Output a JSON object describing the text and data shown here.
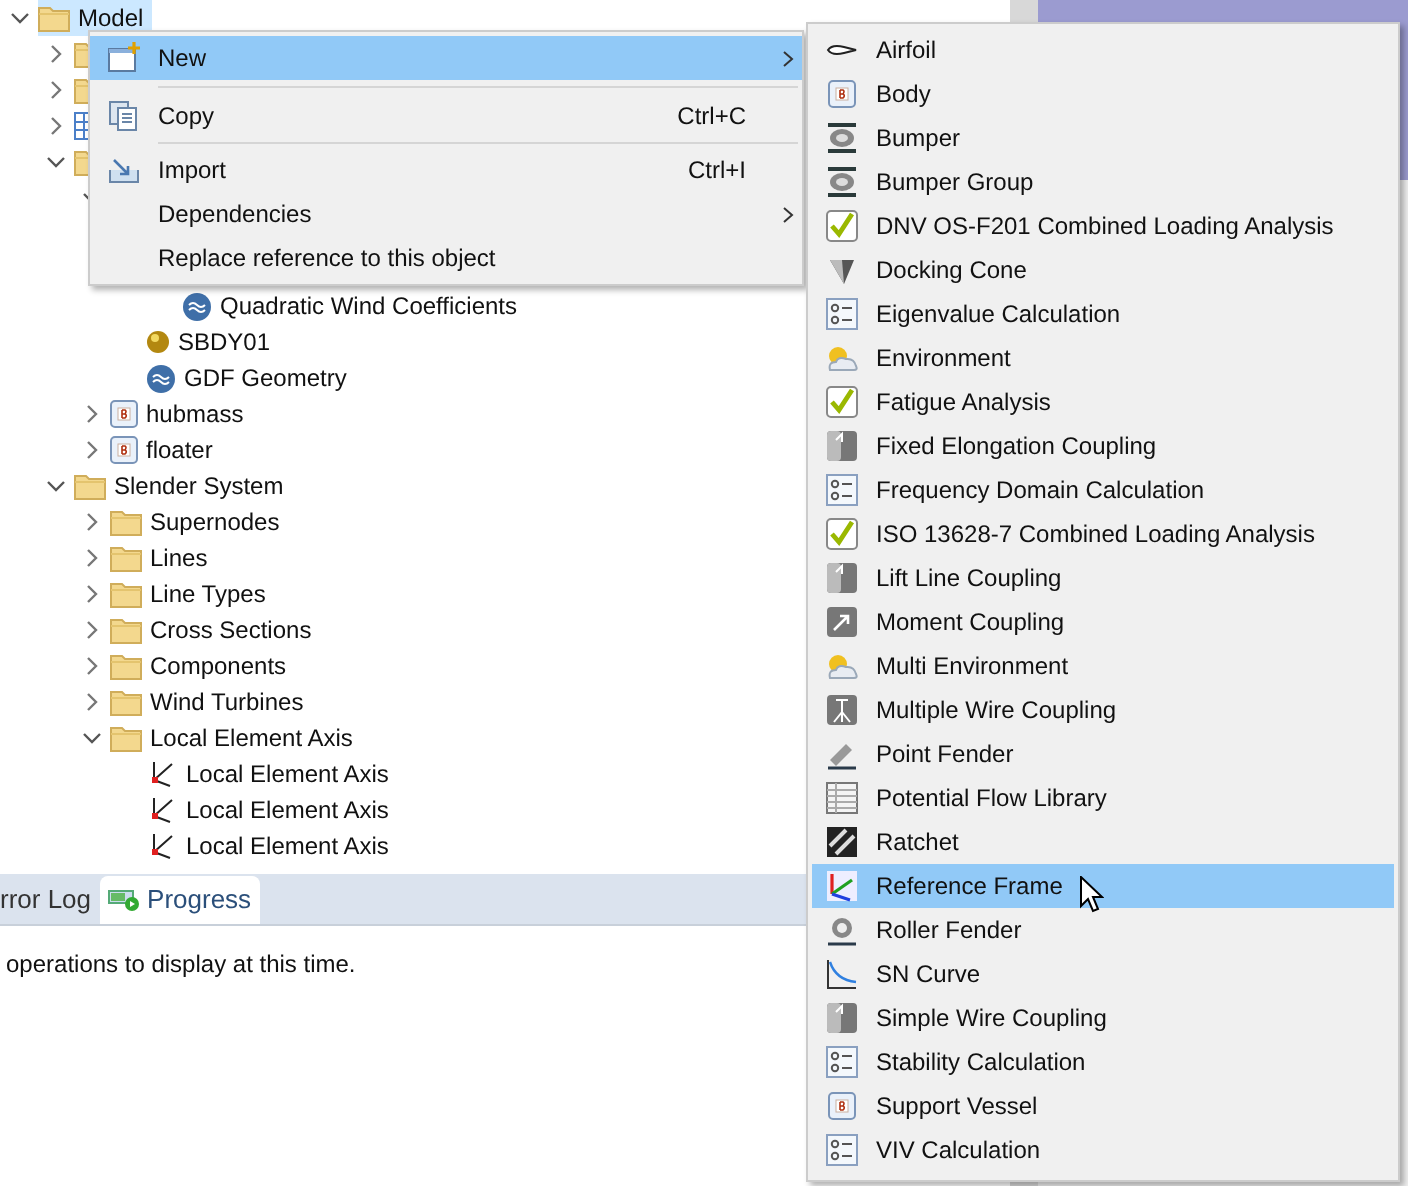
{
  "tree": [
    {
      "label": "Model",
      "kind": "folder",
      "expanded": true,
      "selected": true,
      "children": [
        {
          "kind": "folder",
          "expanded": false
        },
        {
          "kind": "folder",
          "expanded": false
        },
        {
          "kind": "grid",
          "expanded": false
        },
        {
          "kind": "folder",
          "expanded": true,
          "children": [
            {
              "kind": "hidden",
              "expanded": true,
              "children": [
                {
                  "kind": "hidden",
                  "children": [
                    {
                      "kind": "hidden"
                    },
                    {
                      "label": "Quadratic Wind Coefficients",
                      "kind": "wave"
                    }
                  ]
                },
                {
                  "label": "SBDY01",
                  "kind": "ball"
                },
                {
                  "label": "GDF Geometry",
                  "kind": "wave"
                }
              ]
            },
            {
              "label": "hubmass",
              "kind": "body",
              "expanded": false
            },
            {
              "label": "floater",
              "kind": "body",
              "expanded": false
            }
          ]
        },
        {
          "label": "Slender System",
          "kind": "folder",
          "expanded": true,
          "children": [
            {
              "label": "Supernodes",
              "kind": "folder",
              "expanded": false
            },
            {
              "label": "Lines",
              "kind": "folder",
              "expanded": false
            },
            {
              "label": "Line Types",
              "kind": "folder",
              "expanded": false
            },
            {
              "label": "Cross Sections",
              "kind": "folder",
              "expanded": false
            },
            {
              "label": "Components",
              "kind": "folder",
              "expanded": false
            },
            {
              "label": "Wind Turbines",
              "kind": "folder",
              "expanded": false
            },
            {
              "label": "Local Element Axis",
              "kind": "folder",
              "expanded": true,
              "children": [
                {
                  "label": "Local Element Axis",
                  "kind": "axis"
                },
                {
                  "label": "Local Element Axis",
                  "kind": "axis"
                },
                {
                  "label": "Local Element Axis",
                  "kind": "axis"
                }
              ]
            }
          ]
        }
      ]
    }
  ],
  "bottom_panel": {
    "tabs": [
      {
        "label": "rror Log",
        "selected": false
      },
      {
        "label": "Progress",
        "selected": true
      }
    ],
    "message": "operations to display at this time."
  },
  "context_menu": {
    "items": [
      {
        "kind": "new",
        "label": "New",
        "submenu": true,
        "selected": true
      },
      {
        "kind": "separator"
      },
      {
        "kind": "copy",
        "label": "Copy",
        "shortcut": "Ctrl+C",
        "submenu": false,
        "selected": false
      },
      {
        "kind": "separator"
      },
      {
        "kind": "import",
        "label": "Import",
        "shortcut": "Ctrl+I",
        "submenu": false,
        "selected": false
      },
      {
        "kind": "plain",
        "label": "Dependencies",
        "submenu": true,
        "selected": false
      },
      {
        "kind": "plain",
        "label": "Replace reference to this object",
        "submenu": false,
        "selected": false
      }
    ]
  },
  "submenu": {
    "items": [
      {
        "label": "Airfoil",
        "kind": "airfoil",
        "selected": false
      },
      {
        "label": "Body",
        "kind": "body",
        "selected": false
      },
      {
        "label": "Bumper",
        "kind": "bumper",
        "selected": false
      },
      {
        "label": "Bumper Group",
        "kind": "bumper",
        "selected": false
      },
      {
        "label": "DNV OS-F201 Combined Loading Analysis",
        "kind": "check",
        "selected": false
      },
      {
        "label": "Docking Cone",
        "kind": "cone",
        "selected": false
      },
      {
        "label": "Eigenvalue Calculation",
        "kind": "list",
        "selected": false
      },
      {
        "label": "Environment",
        "kind": "weather",
        "selected": false
      },
      {
        "label": "Fatigue Analysis",
        "kind": "check",
        "selected": false
      },
      {
        "label": "Fixed Elongation Coupling",
        "kind": "coupling",
        "selected": false
      },
      {
        "label": "Frequency Domain Calculation",
        "kind": "list",
        "selected": false
      },
      {
        "label": "ISO 13628-7 Combined Loading Analysis",
        "kind": "check",
        "selected": false
      },
      {
        "label": "Lift Line Coupling",
        "kind": "coupling",
        "selected": false
      },
      {
        "label": "Moment Coupling",
        "kind": "moment",
        "selected": false
      },
      {
        "label": "Multi Environment",
        "kind": "weather",
        "selected": false
      },
      {
        "label": "Multiple Wire Coupling",
        "kind": "wire",
        "selected": false
      },
      {
        "label": "Point Fender",
        "kind": "fender",
        "selected": false
      },
      {
        "label": "Potential Flow Library",
        "kind": "table",
        "selected": false
      },
      {
        "label": "Ratchet",
        "kind": "ratchet",
        "selected": false
      },
      {
        "label": "Reference Frame",
        "kind": "axes",
        "selected": true
      },
      {
        "label": "Roller Fender",
        "kind": "roller",
        "selected": false
      },
      {
        "label": "SN Curve",
        "kind": "curve",
        "selected": false
      },
      {
        "label": "Simple Wire Coupling",
        "kind": "coupling",
        "selected": false
      },
      {
        "label": "Stability Calculation",
        "kind": "list",
        "selected": false
      },
      {
        "label": "Support Vessel",
        "kind": "body",
        "selected": false
      },
      {
        "label": "VIV Calculation",
        "kind": "list",
        "selected": false
      }
    ]
  }
}
